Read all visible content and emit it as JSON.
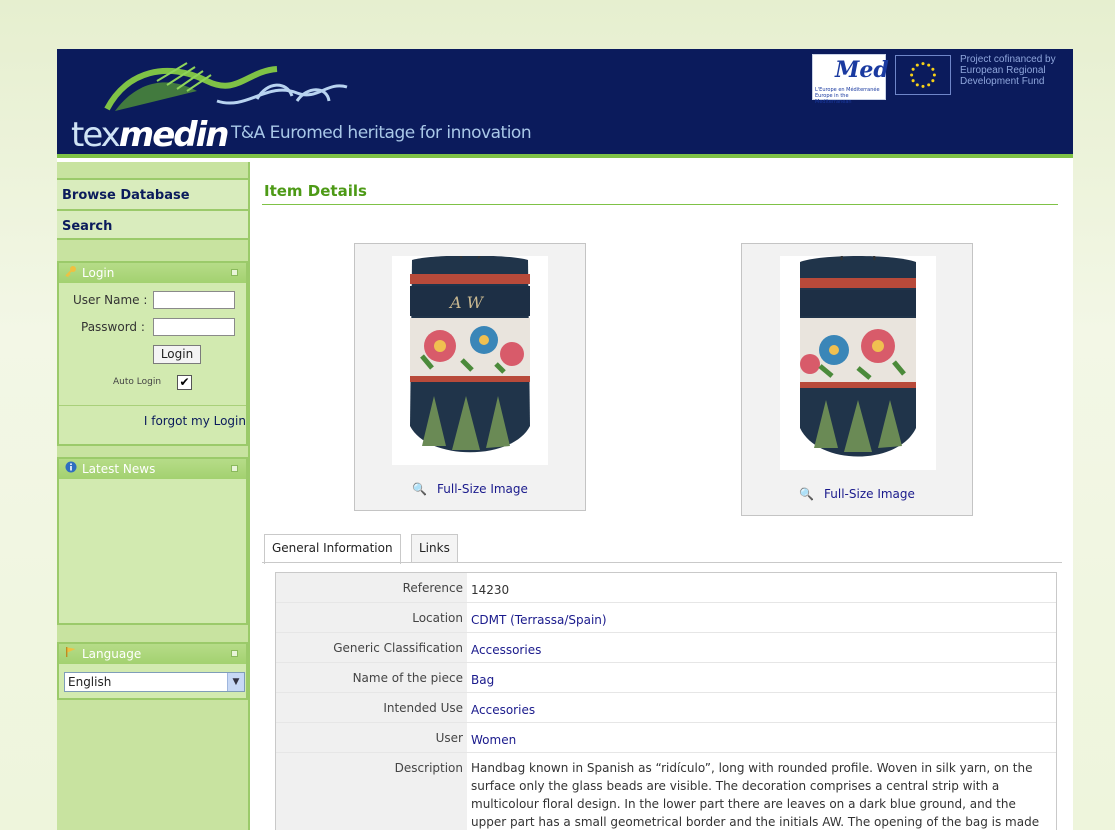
{
  "header": {
    "logo_word_light": "tex",
    "logo_word_bold": "medin",
    "tagline": "T&A Euromed heritage for innovation",
    "med_logo_text": "Med",
    "med_logo_subtext": "L'Europe en Méditerranée Europe in the Mediterranean",
    "eu_text": "Project cofinanced by European Regional Development Fund"
  },
  "sidebar": {
    "nav": [
      {
        "label": "Browse Database"
      },
      {
        "label": "Search"
      }
    ],
    "login": {
      "title": "Login",
      "username_label": "User Name :",
      "password_label": "Password :",
      "button_label": "Login",
      "autologin_label": "Auto Login",
      "autologin_checked": true,
      "forgot_label": "I forgot my Login"
    },
    "news": {
      "title": "Latest News"
    },
    "language": {
      "title": "Language",
      "selected": "English"
    }
  },
  "main": {
    "title": "Item Details",
    "images": [
      {
        "link_label": "Full-Size Image"
      },
      {
        "link_label": "Full-Size Image"
      }
    ],
    "tabs": [
      {
        "label": "General Information",
        "active": true
      },
      {
        "label": "Links",
        "active": false
      }
    ],
    "rows": [
      {
        "label": "Reference",
        "value": "14230"
      },
      {
        "label": "Location",
        "value": "CDMT (Terrassa/Spain)"
      },
      {
        "label": "Generic Classification",
        "value": "Accessories"
      },
      {
        "label": "Name of the piece",
        "value": "Bag"
      },
      {
        "label": "Intended Use",
        "value": "Accesories"
      },
      {
        "label": "User",
        "value": "Women"
      },
      {
        "label": "Description",
        "value": "Handbag known in Spanish as “ridículo”, long with rounded profile. Woven in silk yarn, on the surface only the glass beads are visible. The decoration comprises a central strip with a multicolour floral design. In the lower part there are leaves on a dark blue ground, and the upper part has a small geometrical border and the initials AW. The opening of the bag is made"
      }
    ]
  },
  "colors": {
    "header_bg": "#0b1b5c",
    "accent_green": "#7fc246",
    "title_green": "#4d9a16",
    "sidebar_bg": "#c8e3a0",
    "link_blue": "#1a1a8c"
  }
}
